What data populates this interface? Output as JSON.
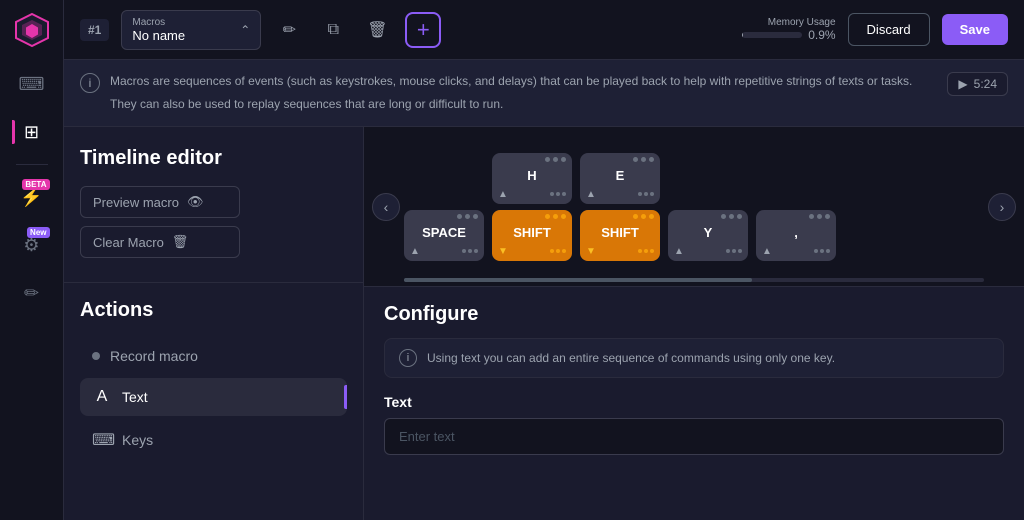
{
  "sidebar": {
    "logo_color": "#e535ab",
    "items": [
      {
        "id": "keyboard",
        "icon": "⌨",
        "active": false,
        "badge": null
      },
      {
        "id": "layers",
        "icon": "⊞",
        "active": true,
        "badge": null
      },
      {
        "id": "lightning",
        "icon": "⚡",
        "active": false,
        "badge": "BETA"
      },
      {
        "id": "settings",
        "icon": "⚙",
        "active": false,
        "badge": "New"
      },
      {
        "id": "draw",
        "icon": "✏",
        "active": false,
        "badge": null
      }
    ]
  },
  "topbar": {
    "macro_number": "#1",
    "macro_label": "Macros",
    "macro_name": "No name",
    "memory_label": "Memory Usage",
    "memory_pct": "0.9%",
    "memory_bar_width": "1",
    "discard_label": "Discard",
    "save_label": "Save"
  },
  "info_banner": {
    "text_line1": "Macros are sequences of events (such as keystrokes, mouse clicks, and delays) that can be played back to help with repetitive strings of texts or tasks.",
    "text_line2": "They can also be used to replay sequences that are long or difficult to run.",
    "play_label": "5:24"
  },
  "timeline": {
    "title": "Timeline editor",
    "preview_label": "Preview macro",
    "clear_label": "Clear Macro",
    "blocks": [
      {
        "id": "b1",
        "label": "SPACE",
        "type": "gray",
        "column": 1
      },
      {
        "id": "b2",
        "label": "SHIFT",
        "type": "yellow",
        "column": 2
      },
      {
        "id": "b3",
        "label": "H",
        "type": "gray",
        "column": 3
      },
      {
        "id": "b4",
        "label": "SHIFT",
        "type": "yellow",
        "column": 4
      },
      {
        "id": "b5",
        "label": "E",
        "type": "gray",
        "column": 5
      },
      {
        "id": "b6",
        "label": "Y",
        "type": "gray",
        "column": 6
      },
      {
        "id": "b7",
        "label": ",",
        "type": "gray",
        "column": 7
      }
    ]
  },
  "actions": {
    "title": "Actions",
    "items": [
      {
        "id": "record",
        "label": "Record macro",
        "icon": "dot",
        "active": false
      },
      {
        "id": "text",
        "label": "Text",
        "icon": "A",
        "active": true
      },
      {
        "id": "keys",
        "label": "Keys",
        "icon": "⌨",
        "active": false
      }
    ]
  },
  "configure": {
    "title": "Configure",
    "info_text": "Using text you can add an entire sequence of commands using only one key.",
    "field_label": "Text",
    "input_placeholder": "Enter text"
  }
}
